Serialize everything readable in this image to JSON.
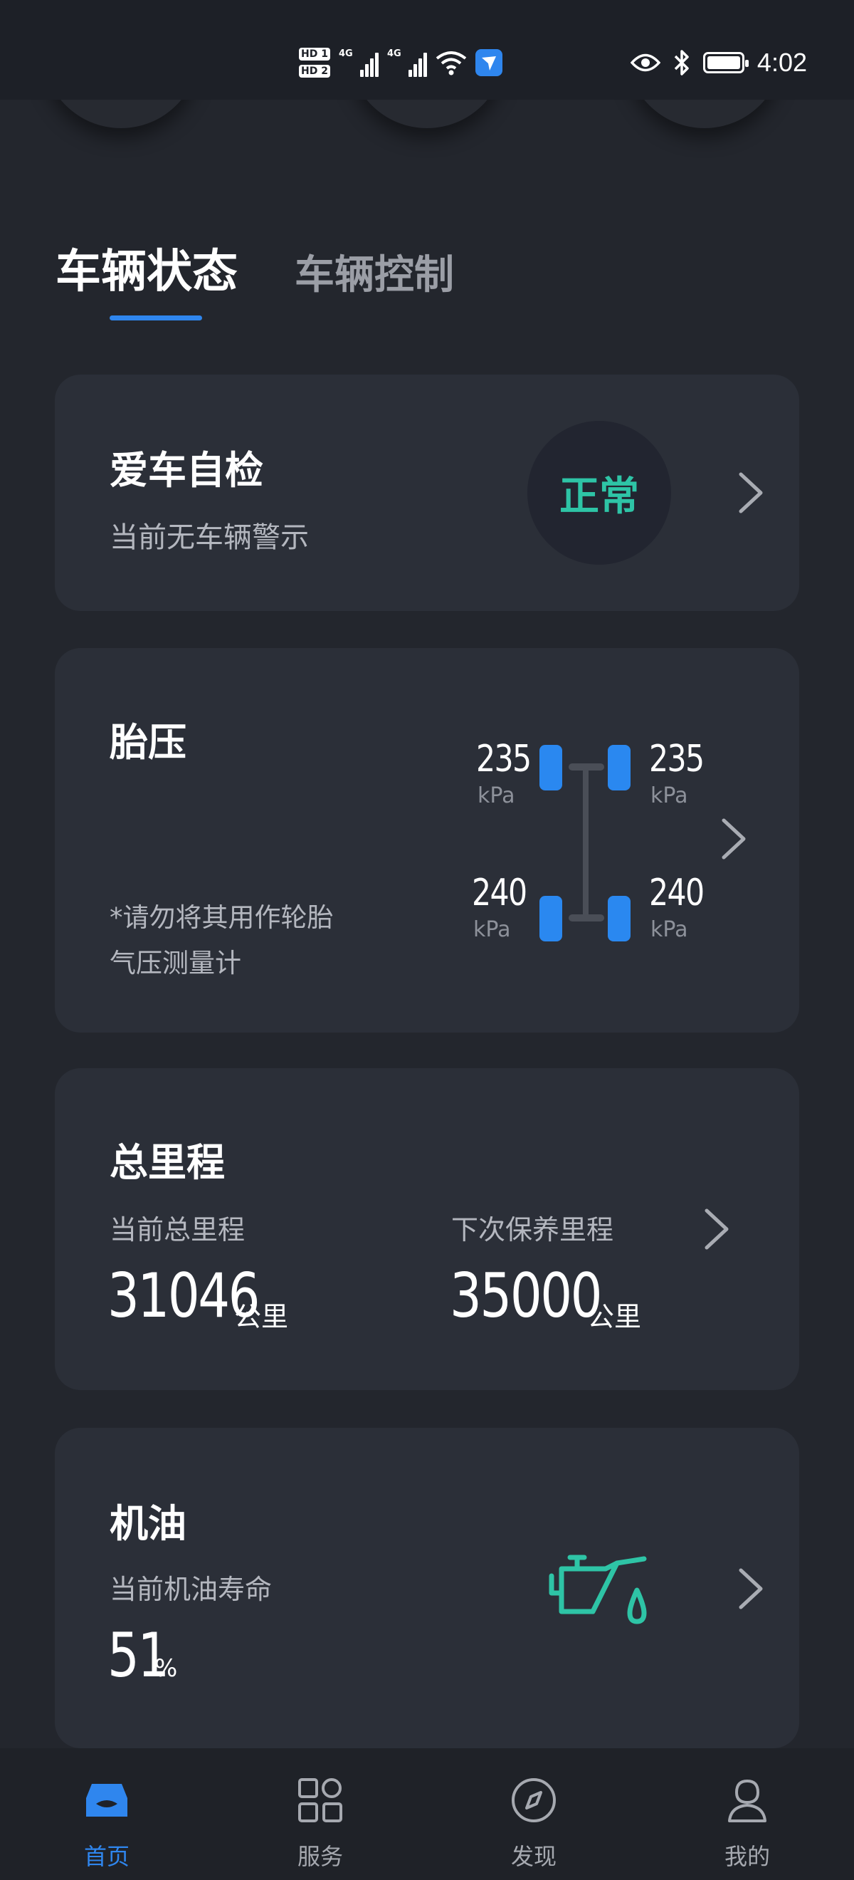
{
  "status_bar": {
    "sim1": "HD 1",
    "sim2": "HD 2",
    "net1": "4G",
    "net2": "4G",
    "time": "4:02"
  },
  "tabs": [
    {
      "label": "车辆状态",
      "active": true
    },
    {
      "label": "车辆控制",
      "active": false
    }
  ],
  "self_check": {
    "title": "爱车自检",
    "subtitle": "当前无车辆警示",
    "status": "正常"
  },
  "tire_pressure": {
    "title": "胎压",
    "note_line1": "*请勿将其用作轮胎",
    "note_line2": "气压测量计",
    "front_left": "235",
    "front_right": "235",
    "rear_left": "240",
    "rear_right": "240",
    "unit": "kPa"
  },
  "mileage": {
    "title": "总里程",
    "current_label": "当前总里程",
    "current_value": "31046",
    "next_label": "下次保养里程",
    "next_value": "35000",
    "unit": "公里"
  },
  "oil": {
    "title": "机油",
    "label": "当前机油寿命",
    "value": "51",
    "unit": "%",
    "life_percent": 51
  },
  "bottom_nav": [
    {
      "label": "首页",
      "icon": "car-home-icon",
      "active": true
    },
    {
      "label": "服务",
      "icon": "grid-icon",
      "active": false
    },
    {
      "label": "发现",
      "icon": "compass-icon",
      "active": false
    },
    {
      "label": "我的",
      "icon": "profile-icon",
      "active": false
    }
  ],
  "colors": {
    "accent": "#2f86ee",
    "ok_green": "#2ec4a6",
    "card_bg": "#2b2f38",
    "page_bg": "#23262d"
  }
}
